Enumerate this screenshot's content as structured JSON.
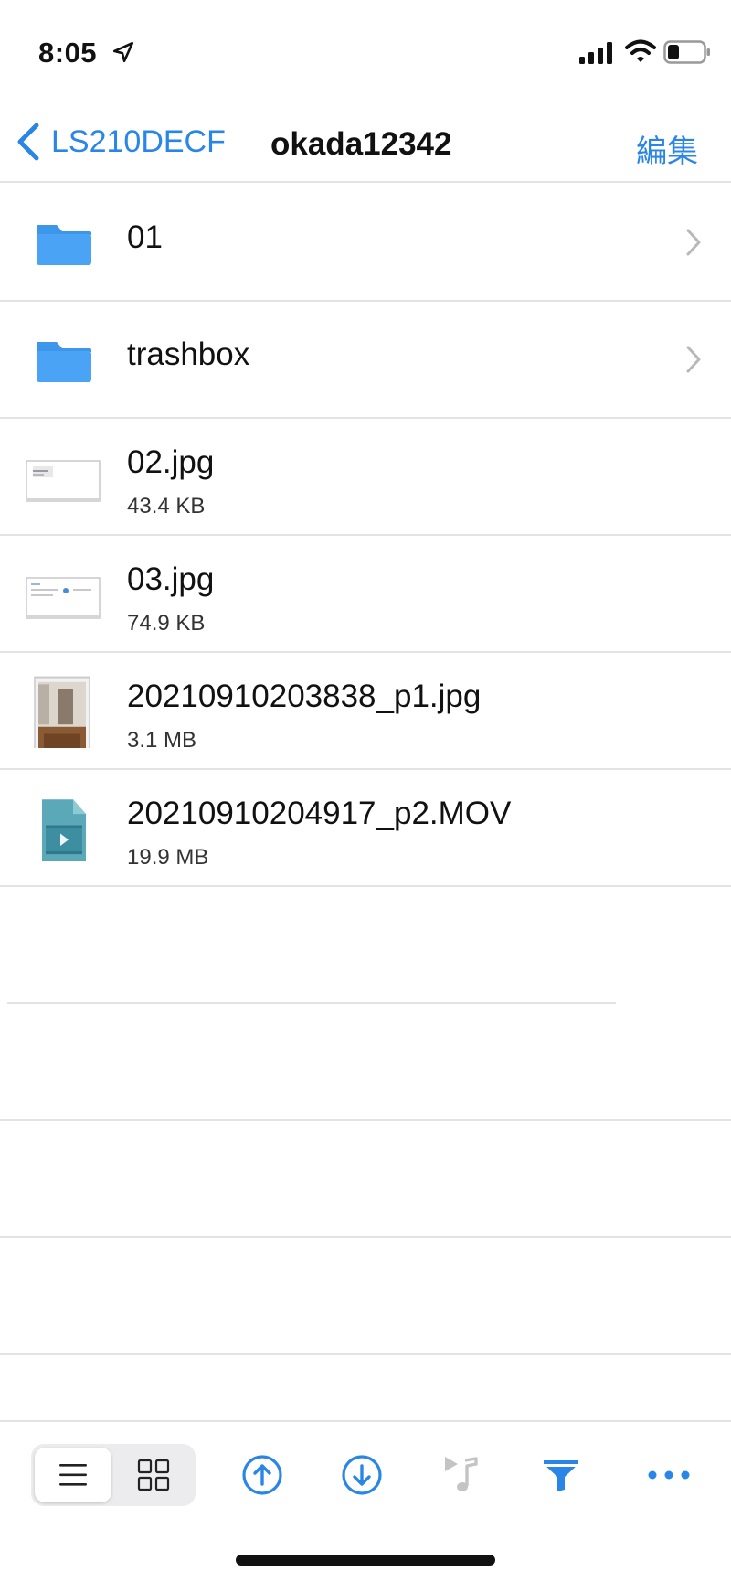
{
  "status_bar": {
    "time": "8:05"
  },
  "nav": {
    "back_label": "LS210DECF",
    "title": "okada12342",
    "edit_label": "編集"
  },
  "files": [
    {
      "name": "01",
      "size": "",
      "kind": "folder"
    },
    {
      "name": "trashbox",
      "size": "",
      "kind": "folder"
    },
    {
      "name": "02.jpg",
      "size": "43.4 KB",
      "kind": "image"
    },
    {
      "name": "03.jpg",
      "size": "74.9 KB",
      "kind": "image"
    },
    {
      "name": "20210910203838_p1.jpg",
      "size": "3.1 MB",
      "kind": "photo"
    },
    {
      "name": "20210910204917_p2.MOV",
      "size": "19.9 MB",
      "kind": "video"
    }
  ],
  "toolbar": {
    "icons": [
      "list-view-icon",
      "grid-view-icon",
      "upload-icon",
      "download-icon",
      "music-icon",
      "filter-icon",
      "more-icon"
    ]
  },
  "colors": {
    "accent": "#2a86e6",
    "folder": "#4ba3f5",
    "video": "#5aa8b8",
    "disabled": "#c4c4c6"
  }
}
